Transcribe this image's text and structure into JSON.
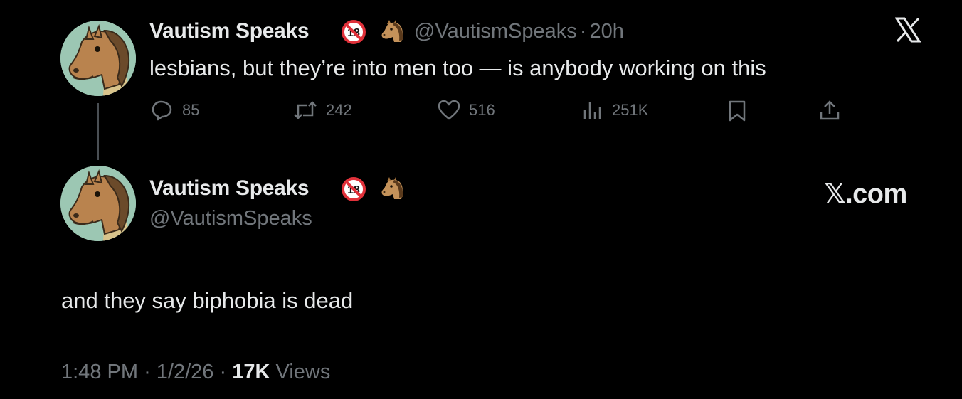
{
  "colors": {
    "background": "#000000",
    "text_primary": "#e7e9ea",
    "text_secondary": "#71767b",
    "thread_line": "#4a4f54"
  },
  "quoted_tweet": {
    "author_name": "Vautism Speaks",
    "author_handle": "@VautismSpeaks",
    "separator": "·",
    "age": "20h",
    "badge_icon": "no-under-18-icon",
    "emoji_icon": "horse-face-icon",
    "text": "lesbians, but they’re into men too — is anybody working on this",
    "actions": {
      "replies": "85",
      "reposts": "242",
      "likes": "516",
      "views": "251K"
    },
    "brand_icon": "x-logo-icon"
  },
  "main_tweet": {
    "author_name": "Vautism Speaks",
    "author_handle": "@VautismSpeaks",
    "badge_icon": "no-under-18-icon",
    "emoji_icon": "horse-face-icon",
    "brand_text": "𝕏.com",
    "text": "and they say biphobia is dead",
    "time": "1:48 PM",
    "date": "1/2/26",
    "sep": "·",
    "views_count": "17K",
    "views_label": "Views"
  }
}
